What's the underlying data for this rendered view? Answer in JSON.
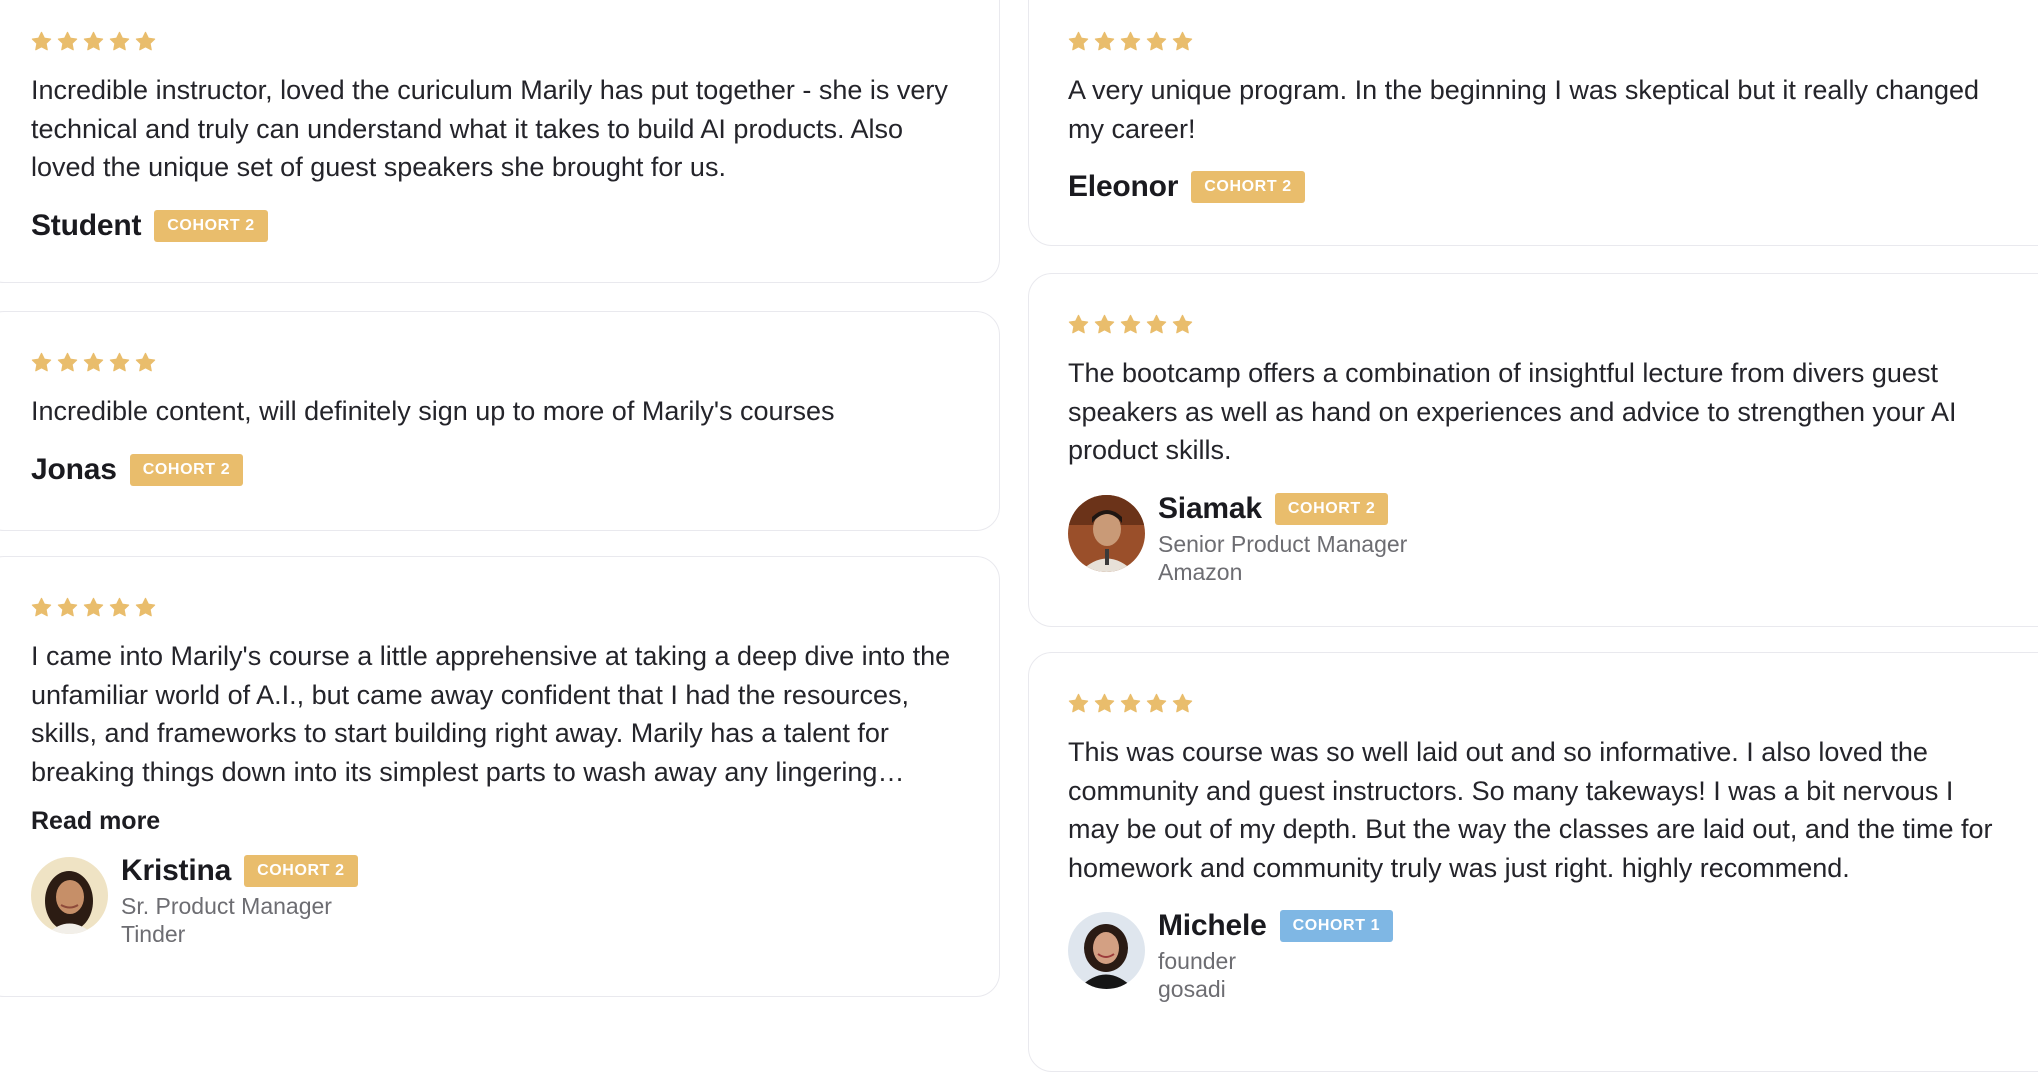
{
  "colors": {
    "star": "#e9bd6c",
    "badge_cohort_2": "#e9bd6c",
    "badge_cohort_1": "#7fb7e4"
  },
  "star_rating": 5,
  "reviews_left": [
    {
      "text": "Incredible instructor, loved the curiculum Marily has put together - she is very technical and truly can understand what it takes to build AI products. Also loved the unique set of guest speakers she brought for us.",
      "name": "Student",
      "badge": "COHORT 2"
    },
    {
      "text": "Incredible content, will definitely sign up to more of Marily's courses",
      "name": "Jonas",
      "badge": "COHORT 2"
    },
    {
      "text": "I came into Marily's course a little apprehensive at taking a deep dive into the unfamiliar world of A.I., but came away confident that I had the resources, skills, and frameworks to start building right away. Marily has a talent for breaking things down into its simplest parts to wash away any lingering confusion.",
      "read_more": "Read more",
      "name": "Kristina",
      "badge": "COHORT 2",
      "role": "Sr. Product Manager",
      "company": "Tinder"
    }
  ],
  "reviews_right": [
    {
      "text": "A very unique program. In the beginning I was skeptical but it really changed my career!",
      "name": "Eleonor",
      "badge": "COHORT 2"
    },
    {
      "text": "The bootcamp offers a combination of insightful lecture from divers guest speakers as well as hand on experiences and advice to strengthen your AI product skills.",
      "name": "Siamak",
      "badge": "COHORT 2",
      "role": "Senior Product Manager",
      "company": "Amazon"
    },
    {
      "text": "This was course was so well laid out and so informative. I also loved the community and guest instructors. So many takeways! I was a bit nervous I may be out of my depth. But the way the classes are laid out, and the time for homework and community truly was just right. highly recommend.",
      "name": "Michele",
      "badge": "COHORT 1",
      "role": "founder",
      "company": "gosadi"
    }
  ]
}
